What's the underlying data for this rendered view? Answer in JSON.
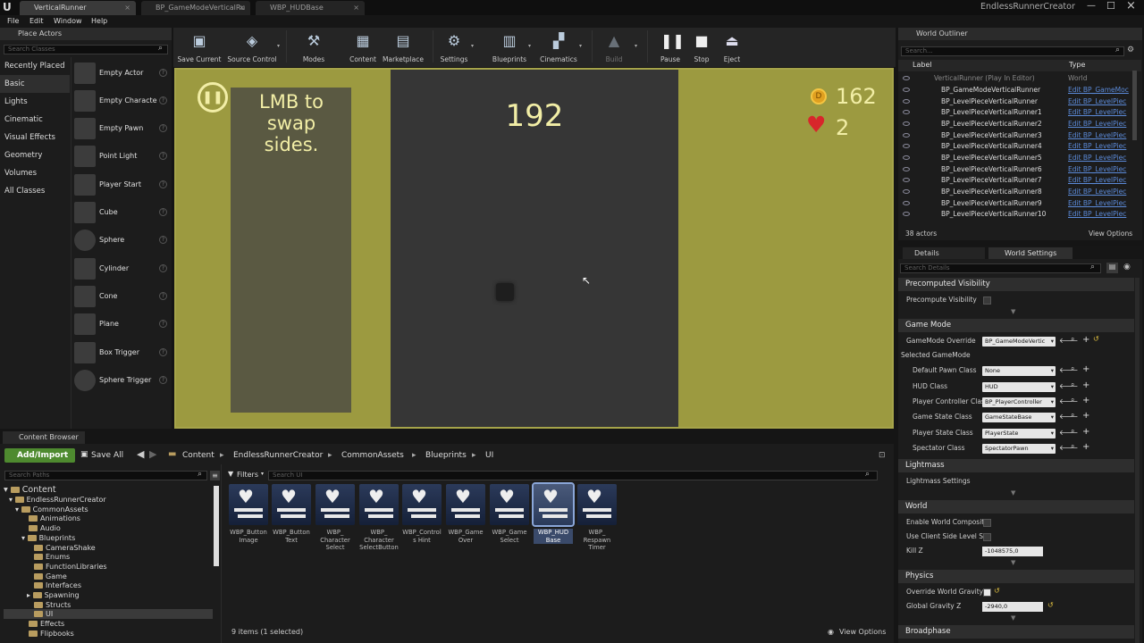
{
  "window": {
    "tabs": [
      "VerticalRunner",
      "BP_GameModeVerticalRu",
      "WBP_HUDBase"
    ],
    "project": "EndlessRunnerCreator"
  },
  "menu": [
    "File",
    "Edit",
    "Window",
    "Help"
  ],
  "place_actors": {
    "title": "Place Actors",
    "search_placeholder": "Search Classes",
    "categories": [
      "Recently Placed",
      "Basic",
      "Lights",
      "Cinematic",
      "Visual Effects",
      "Geometry",
      "Volumes",
      "All Classes"
    ],
    "selected_category": "Basic",
    "items": [
      "Empty Actor",
      "Empty Characte",
      "Empty Pawn",
      "Point Light",
      "Player Start",
      "Cube",
      "Sphere",
      "Cylinder",
      "Cone",
      "Plane",
      "Box Trigger",
      "Sphere Trigger"
    ]
  },
  "toolbar": [
    {
      "label": "Save Current",
      "icon": "save-icon"
    },
    {
      "label": "Source Control",
      "icon": "source-control-icon"
    },
    {
      "label": "Modes",
      "icon": "modes-icon"
    },
    {
      "label": "Content",
      "icon": "content-icon"
    },
    {
      "label": "Marketplace",
      "icon": "marketplace-icon"
    },
    {
      "label": "Settings",
      "icon": "settings-icon"
    },
    {
      "label": "Blueprints",
      "icon": "blueprints-icon"
    },
    {
      "label": "Cinematics",
      "icon": "cinematics-icon"
    },
    {
      "label": "Build",
      "icon": "build-icon"
    },
    {
      "label": "Pause",
      "icon": "pause-icon"
    },
    {
      "label": "Stop",
      "icon": "stop-icon"
    },
    {
      "label": "Eject",
      "icon": "eject-icon"
    }
  ],
  "viewport": {
    "hint": "LMB to\nswap\nsides.",
    "score": "192",
    "coins": "162",
    "lives": "2",
    "colors": {
      "wall": "#9c9a40",
      "road": "#363636",
      "panel": "#5a5942",
      "hud_text": "#f2eea6"
    }
  },
  "outliner": {
    "title": "World Outliner",
    "search_placeholder": "Search...",
    "col_label": "Label",
    "col_type": "Type",
    "world_row": {
      "label": "VerticalRunner (Play In Editor)",
      "type": "World"
    },
    "rows": [
      {
        "label": "BP_GameModeVerticalRunner",
        "type": "Edit BP_GameMoc"
      },
      {
        "label": "BP_LevelPieceVerticalRunner",
        "type": "Edit BP_LevelPiec"
      },
      {
        "label": "BP_LevelPieceVerticalRunner1",
        "type": "Edit BP_LevelPiec"
      },
      {
        "label": "BP_LevelPieceVerticalRunner2",
        "type": "Edit BP_LevelPiec"
      },
      {
        "label": "BP_LevelPieceVerticalRunner3",
        "type": "Edit BP_LevelPiec"
      },
      {
        "label": "BP_LevelPieceVerticalRunner4",
        "type": "Edit BP_LevelPiec"
      },
      {
        "label": "BP_LevelPieceVerticalRunner5",
        "type": "Edit BP_LevelPiec"
      },
      {
        "label": "BP_LevelPieceVerticalRunner6",
        "type": "Edit BP_LevelPiec"
      },
      {
        "label": "BP_LevelPieceVerticalRunner7",
        "type": "Edit BP_LevelPiec"
      },
      {
        "label": "BP_LevelPieceVerticalRunner8",
        "type": "Edit BP_LevelPiec"
      },
      {
        "label": "BP_LevelPieceVerticalRunner9",
        "type": "Edit BP_LevelPiec"
      },
      {
        "label": "BP_LevelPieceVerticalRunner10",
        "type": "Edit BP_LevelPiec"
      }
    ],
    "count": "38 actors",
    "view_options": "View Options"
  },
  "details": {
    "tab_details": "Details",
    "tab_world": "World Settings",
    "search_placeholder": "Search Details",
    "sections": {
      "precomputed": "Precomputed Visibility",
      "game_mode": "Game Mode",
      "selected_gm": "Selected GameMode",
      "lightmass": "Lightmass",
      "lightmass_settings": "Lightmass Settings",
      "world": "World",
      "physics": "Physics",
      "broadphase": "Broadphase"
    },
    "precompute_visibility": "Precompute Visibility",
    "gamemode_override": {
      "label": "GameMode Override",
      "value": "BP_GameModeVertic"
    },
    "classes": [
      {
        "label": "Default Pawn Class",
        "value": "None"
      },
      {
        "label": "HUD Class",
        "value": "HUD"
      },
      {
        "label": "Player Controller Clas",
        "value": "BP_PlayerController"
      },
      {
        "label": "Game State Class",
        "value": "GameStateBase"
      },
      {
        "label": "Player State Class",
        "value": "PlayerState"
      },
      {
        "label": "Spectator Class",
        "value": "SpectatorPawn"
      }
    ],
    "enable_world_composition": "Enable World Compositic",
    "use_client_side": "Use Client Side Level Str",
    "kill_z": {
      "label": "Kill Z",
      "value": "-1048575,0"
    },
    "override_gravity": "Override World Gravity",
    "global_gravity": {
      "label": "Global Gravity Z",
      "value": "-2940,0"
    }
  },
  "content_browser": {
    "title": "Content Browser",
    "add_import": "Add/Import",
    "save_all": "Save All",
    "breadcrumb": [
      "Content",
      "EndlessRunnerCreator",
      "CommonAssets",
      "Blueprints",
      "UI"
    ],
    "search_paths": "Search Paths",
    "filters": "Filters",
    "search_ui": "Search UI",
    "tree": [
      {
        "label": "Content",
        "depth": 0
      },
      {
        "label": "EndlessRunnerCreator",
        "depth": 1
      },
      {
        "label": "CommonAssets",
        "depth": 2
      },
      {
        "label": "Animations",
        "depth": 3
      },
      {
        "label": "Audio",
        "depth": 3
      },
      {
        "label": "Blueprints",
        "depth": 3
      },
      {
        "label": "CameraShake",
        "depth": 4
      },
      {
        "label": "Enums",
        "depth": 4
      },
      {
        "label": "FunctionLibraries",
        "depth": 4
      },
      {
        "label": "Game",
        "depth": 4
      },
      {
        "label": "Interfaces",
        "depth": 4
      },
      {
        "label": "Spawning",
        "depth": 4
      },
      {
        "label": "Structs",
        "depth": 4
      },
      {
        "label": "UI",
        "depth": 4
      },
      {
        "label": "Effects",
        "depth": 3
      },
      {
        "label": "Flipbooks",
        "depth": 3
      }
    ],
    "assets": [
      "WBP_Button Image",
      "WBP_Button Text",
      "WBP_ Character Select",
      "WBP_ Character SelectButton",
      "WBP_Controls Hint",
      "WBP_Game Over",
      "WBP_Game Select",
      "WBP_HUD Base",
      "WBP_ Respawn Timer"
    ],
    "selected_asset": "WBP_HUD Base",
    "status": "9 items (1 selected)",
    "view_options": "View Options"
  }
}
